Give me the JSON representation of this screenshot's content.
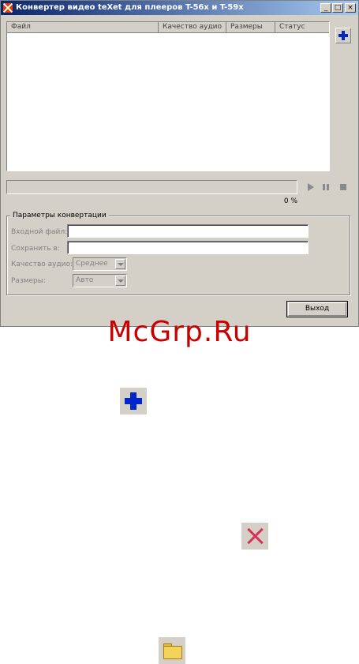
{
  "window": {
    "title": "Конвертер видео teXet для плееров T-56x и T-59x",
    "minimize_glyph": "_",
    "maximize_glyph": "□",
    "close_glyph": "×"
  },
  "file_list": {
    "columns": [
      "Файл",
      "Качество аудио",
      "Размеры",
      "Статус"
    ]
  },
  "progress": {
    "value_percent": 0,
    "label": "0 %"
  },
  "params": {
    "group_title": "Параметры конвертации",
    "input_file_label": "Входной файл:",
    "input_file_value": "",
    "save_to_label": "Сохранить в:",
    "save_to_value": "",
    "audio_quality_label": "Качество аудио:",
    "audio_quality_value": "Среднее",
    "size_label": "Размеры:",
    "size_value": "Авто"
  },
  "buttons": {
    "exit_label": "Выход"
  },
  "watermark": "McGrp.Ru",
  "icons": {
    "add": "plus-icon",
    "delete": "delete-icon",
    "folder": "folder-icon",
    "accent_blue": "#0025c8",
    "delete_red": "#d8325a"
  }
}
